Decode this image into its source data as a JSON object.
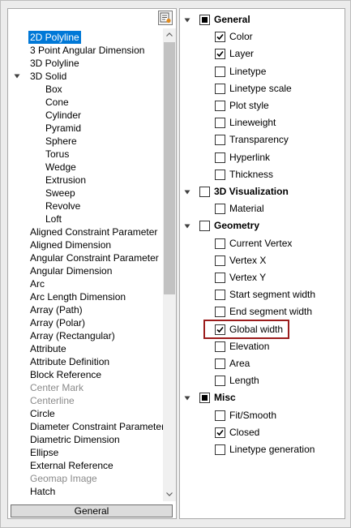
{
  "left_panel": {
    "items": [
      {
        "label": "2D Polyline",
        "selected": true
      },
      {
        "label": "3 Point Angular Dimension"
      },
      {
        "label": "3D Polyline"
      },
      {
        "label": "3D Solid",
        "expandable": true,
        "expanded": true
      },
      {
        "label": "Box",
        "child": true
      },
      {
        "label": "Cone",
        "child": true
      },
      {
        "label": "Cylinder",
        "child": true
      },
      {
        "label": "Pyramid",
        "child": true
      },
      {
        "label": "Sphere",
        "child": true
      },
      {
        "label": "Torus",
        "child": true
      },
      {
        "label": "Wedge",
        "child": true
      },
      {
        "label": "Extrusion",
        "child": true
      },
      {
        "label": "Sweep",
        "child": true
      },
      {
        "label": "Revolve",
        "child": true
      },
      {
        "label": "Loft",
        "child": true
      },
      {
        "label": "Aligned Constraint Parameter"
      },
      {
        "label": "Aligned Dimension"
      },
      {
        "label": "Angular Constraint Parameter"
      },
      {
        "label": "Angular Dimension"
      },
      {
        "label": "Arc"
      },
      {
        "label": "Arc Length Dimension"
      },
      {
        "label": "Array (Path)"
      },
      {
        "label": "Array (Polar)"
      },
      {
        "label": "Array (Rectangular)"
      },
      {
        "label": "Attribute"
      },
      {
        "label": "Attribute Definition"
      },
      {
        "label": "Block Reference"
      },
      {
        "label": "Center Mark",
        "disabled": true
      },
      {
        "label": "Centerline",
        "disabled": true
      },
      {
        "label": "Circle"
      },
      {
        "label": "Diameter Constraint Parameter"
      },
      {
        "label": "Diametric Dimension"
      },
      {
        "label": "Ellipse"
      },
      {
        "label": "External Reference"
      },
      {
        "label": "Geomap Image",
        "disabled": true
      },
      {
        "label": "Hatch"
      }
    ],
    "bottom_tab": "General"
  },
  "right_panel": {
    "rows": [
      {
        "label": "General",
        "group": true,
        "state": "partial"
      },
      {
        "label": "Color",
        "state": "checked"
      },
      {
        "label": "Layer",
        "state": "checked"
      },
      {
        "label": "Linetype",
        "state": "unchecked"
      },
      {
        "label": "Linetype scale",
        "state": "unchecked"
      },
      {
        "label": "Plot style",
        "state": "unchecked"
      },
      {
        "label": "Lineweight",
        "state": "unchecked"
      },
      {
        "label": "Transparency",
        "state": "unchecked"
      },
      {
        "label": "Hyperlink",
        "state": "unchecked"
      },
      {
        "label": "Thickness",
        "state": "unchecked"
      },
      {
        "label": "3D Visualization",
        "group": true,
        "state": "unchecked"
      },
      {
        "label": "Material",
        "state": "unchecked"
      },
      {
        "label": "Geometry",
        "group": true,
        "state": "unchecked"
      },
      {
        "label": "Current Vertex",
        "state": "unchecked"
      },
      {
        "label": "Vertex X",
        "state": "unchecked"
      },
      {
        "label": "Vertex Y",
        "state": "unchecked"
      },
      {
        "label": "Start segment width",
        "state": "unchecked"
      },
      {
        "label": "End segment width",
        "state": "unchecked"
      },
      {
        "label": "Global width",
        "state": "checked",
        "highlighted": true
      },
      {
        "label": "Elevation",
        "state": "unchecked"
      },
      {
        "label": "Area",
        "state": "unchecked"
      },
      {
        "label": "Length",
        "state": "unchecked"
      },
      {
        "label": "Misc",
        "group": true,
        "state": "partial"
      },
      {
        "label": "Fit/Smooth",
        "state": "unchecked"
      },
      {
        "label": "Closed",
        "state": "checked"
      },
      {
        "label": "Linetype generation",
        "state": "unchecked"
      }
    ]
  },
  "colors": {
    "selection": "#0078d7",
    "highlight_border": "#9b1c1c",
    "disabled_text": "#8a8a8a"
  }
}
